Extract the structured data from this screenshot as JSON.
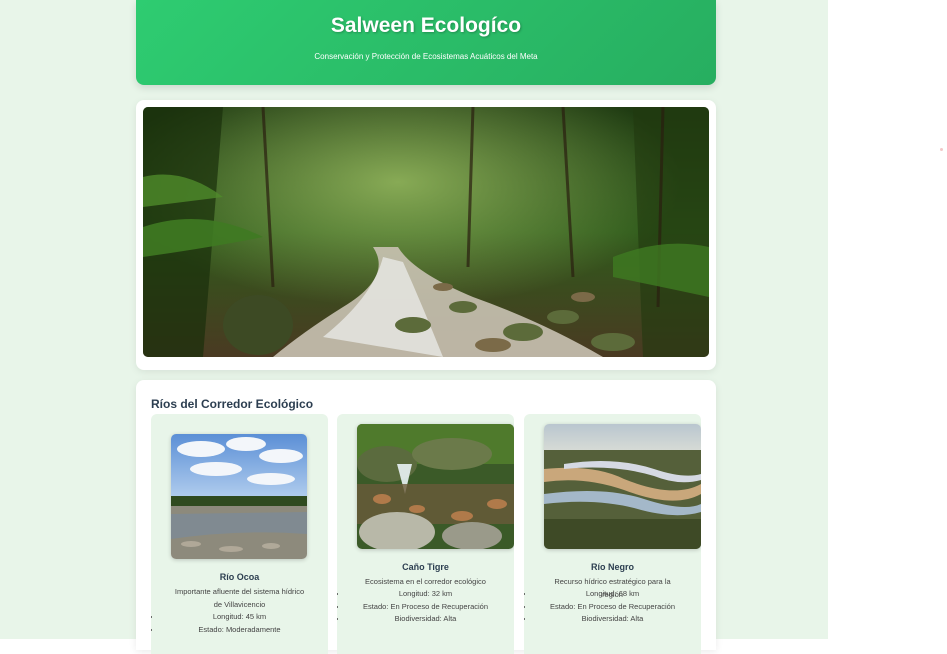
{
  "header": {
    "title": "Salween Ecologíco",
    "subtitle": "Conservación y Protección de Ecosistemas Acuáticos del Meta"
  },
  "rivers_section": {
    "title": "Ríos del Corredor Ecológico",
    "items": [
      {
        "name": "Río Ocoa",
        "description": "Importante afluente del sistema hídrico de Villavicencio",
        "facts": [
          "Longitud: 45 km",
          "Estado: Moderadamente"
        ]
      },
      {
        "name": "Caño Tigre",
        "description": "Ecosistema en el corredor ecológico",
        "facts": [
          "Longitud: 32 km",
          "Estado: En Proceso de Recuperación",
          "Biodiversidad: Alta"
        ]
      },
      {
        "name": "Río Negro",
        "description": "Recurso hídrico estratégico para la región",
        "facts": [
          "Longitud: 68 km",
          "Estado: En Proceso de Recuperación",
          "Biodiversidad: Alta"
        ]
      }
    ]
  },
  "colors": {
    "brand_green": "#2ecc71",
    "page_background": "#e8f5e9",
    "heading_text": "#2c3e50"
  }
}
